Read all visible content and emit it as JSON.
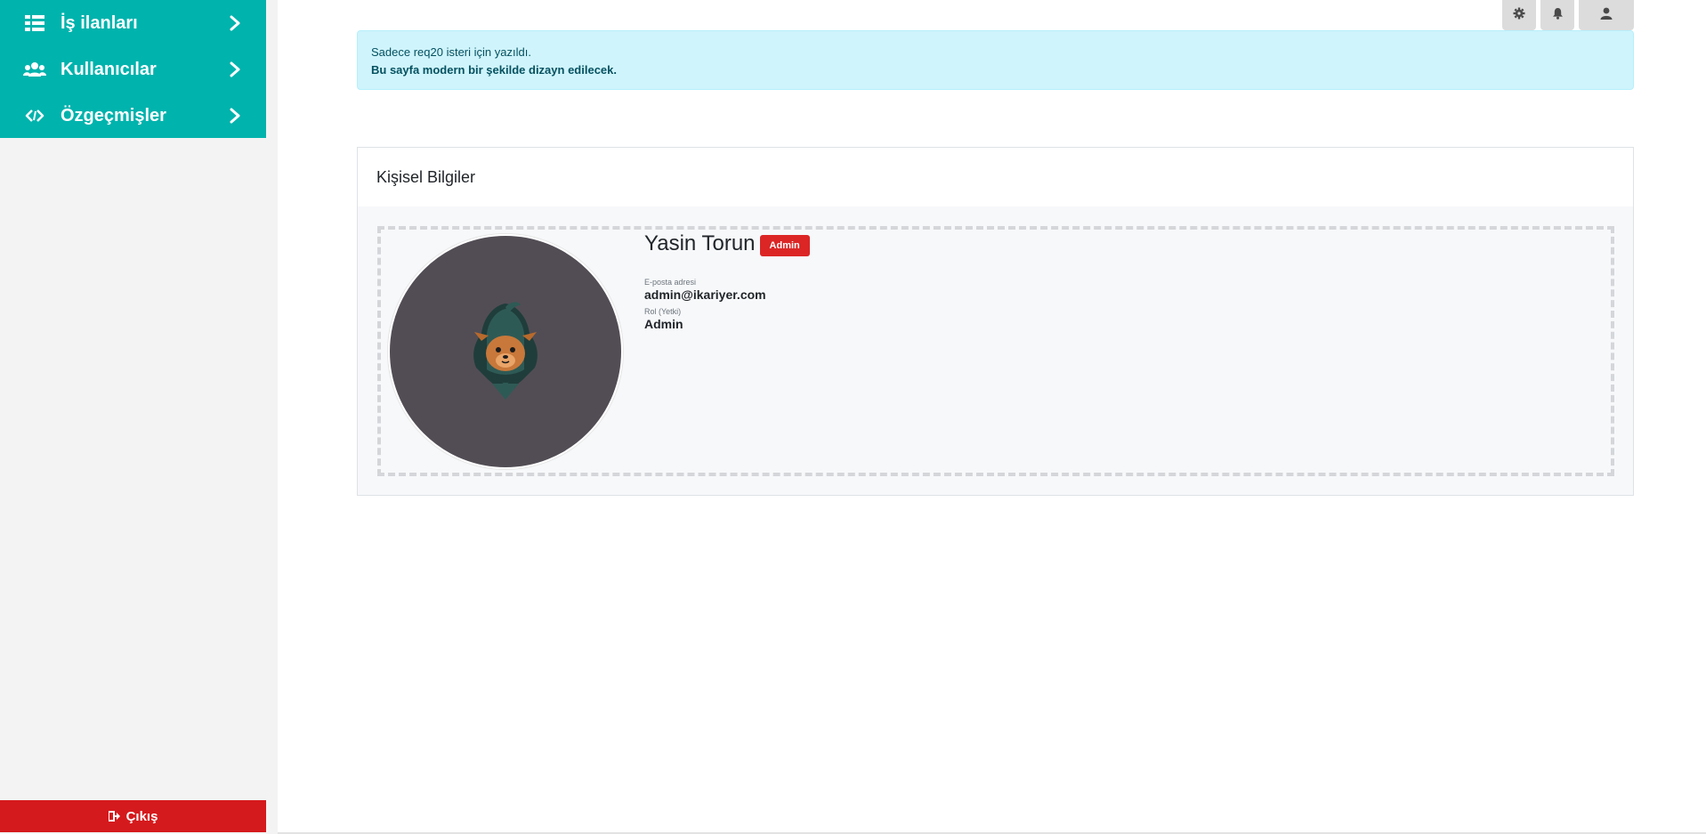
{
  "sidebar": {
    "items": [
      {
        "label": "İş ilanları",
        "icon": "list-icon"
      },
      {
        "label": "Kullanıcılar",
        "icon": "users-icon"
      },
      {
        "label": "Özgeçmişler",
        "icon": "code-icon"
      }
    ],
    "logout_label": "Çıkış"
  },
  "alert": {
    "line1": "Sadece req20 isteri için yazıldı.",
    "line2": "Bu sayfa modern bir şekilde dizayn edilecek."
  },
  "card": {
    "title": "Kişisel Bilgiler",
    "profile": {
      "name": "Yasin Torun",
      "badge": "Admin",
      "email_label": "E-posta adresi",
      "email": "admin@ikariyer.com",
      "role_label": "Rol (Yetki)",
      "role": "Admin"
    }
  },
  "colors": {
    "accent": "#00b3ad",
    "danger": "#d51a1d",
    "badge": "#dc2626",
    "alert_bg": "#cff4fc",
    "avatar_bg": "#524d55"
  }
}
